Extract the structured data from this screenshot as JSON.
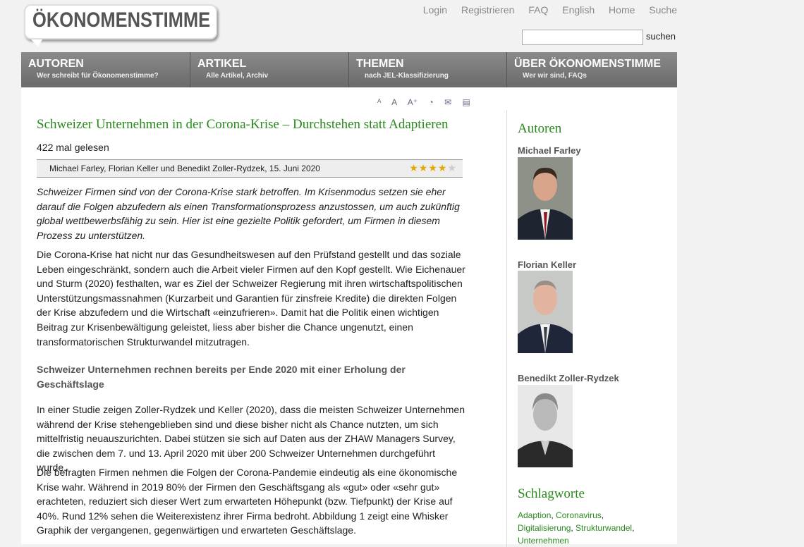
{
  "site": {
    "logo": "ÖKONOMENSTIMME"
  },
  "topnav": [
    "Login",
    "Registrieren",
    "FAQ",
    "English",
    "Home",
    "Suche"
  ],
  "search": {
    "button": "suchen",
    "placeholder": ""
  },
  "mainnav": [
    {
      "title": "AUTOREN",
      "sub": "Wer schreibt für Ökonomenstimme?"
    },
    {
      "title": "ARTIKEL",
      "sub": "Alle Artikel, Archiv"
    },
    {
      "title": "THEMEN",
      "sub": "nach JEL-Klassifizierung"
    },
    {
      "title": "ÜBER ÖKONOMENSTIMME",
      "sub": "Wer wir sind, FAQs"
    }
  ],
  "tools": [
    "font-smaller-icon",
    "font-normal-icon",
    "font-larger-icon",
    "rss-icon",
    "email-icon",
    "print-icon"
  ],
  "article": {
    "title": "Schweizer Unternehmen in der Corona-Krise – Durchstehen statt Adaptieren",
    "reads": "422 mal gelesen",
    "byline": "Michael Farley, Florian Keller und Benedikt Zoller-Rydzek, 15. Juni 2020",
    "rating": 4,
    "lead": "Schweizer Firmen sind von der Corona-Krise stark betroffen. Im Krisenmodus setzen sie eher darauf die Folgen abzufedern als einen Transformationsprozess anzustossen, um auch zukünftig global wettbewerbsfähig zu sein. Hier ist eine gezielte Politik gefordert, um Firmen in diesem Prozess zu unterstützen.",
    "p1": "Die Corona-Krise hat nicht nur das Gesundheitswesen auf den Prüfstand gestellt und das soziale Leben eingeschränkt, sondern auch die Arbeit vieler Firmen auf den Kopf gestellt. Wie Eichenauer und Sturm (2020) festhalten, war es Ziel der Schweizer Regierung mit ihren wirtschaftspolitischen Unterstützungsmassnahmen (Kurzarbeit und Garantien für zinsfreie Kredite) die direkten Folgen der Krise abzufedern und die Wirtschaft «einzufrieren». Damit hat die Politik einen wichtigen Beitrag zur Krisenbewältigung geleistet, liess aber bisher die Chance ungenutzt, einen transformatorischen Strukturwandel mitzutragen.",
    "subhead": "Schweizer Unternehmen rechnen bereits per Ende 2020 mit einer Erholung der Geschäftslage",
    "p2": "In einer Studie zeigen Zoller-Rydzek und Keller (2020), dass die meisten Schweizer Unternehmen während der Krise stehengeblieben sind und diese bisher nicht als Chance nutzten, um sich mittelfristig neuauszurichten. Dabei stützen sie sich auf Daten aus der ZHAW Managers Survey, die zwischen dem 7. und 13. April 2020 mit über 200 Schweizer Unternehmen durchgeführt wurde.",
    "p3": "Die befragten Firmen nehmen die Folgen der Corona-Pandemie eindeutig als eine ökonomische Krise wahr. Während in 2019 80% der Firmen den Geschäftsgang als «gut» oder «sehr gut» erachteten, reduziert sich dieser Wert zum erwarteten Höhepunkt (bzw. Tiefpunkt) der Krise auf 40%. Rund 12% sehen die Weiterexistenz ihrer Firma bedroht. Abbildung 1 zeigt eine Whisker Graphik der vergangenen, gegenwärtigen und erwarteten Geschäftslage."
  },
  "sidebar": {
    "authors_heading": "Autoren",
    "authors": [
      "Michael Farley",
      "Florian Keller",
      "Benedikt Zoller-Rydzek"
    ],
    "tags_heading": "Schlagworte",
    "tags": [
      "Adaption",
      "Coronavirus",
      "Digitalisierung",
      "Strukturwandel",
      "Unternehmen"
    ]
  }
}
